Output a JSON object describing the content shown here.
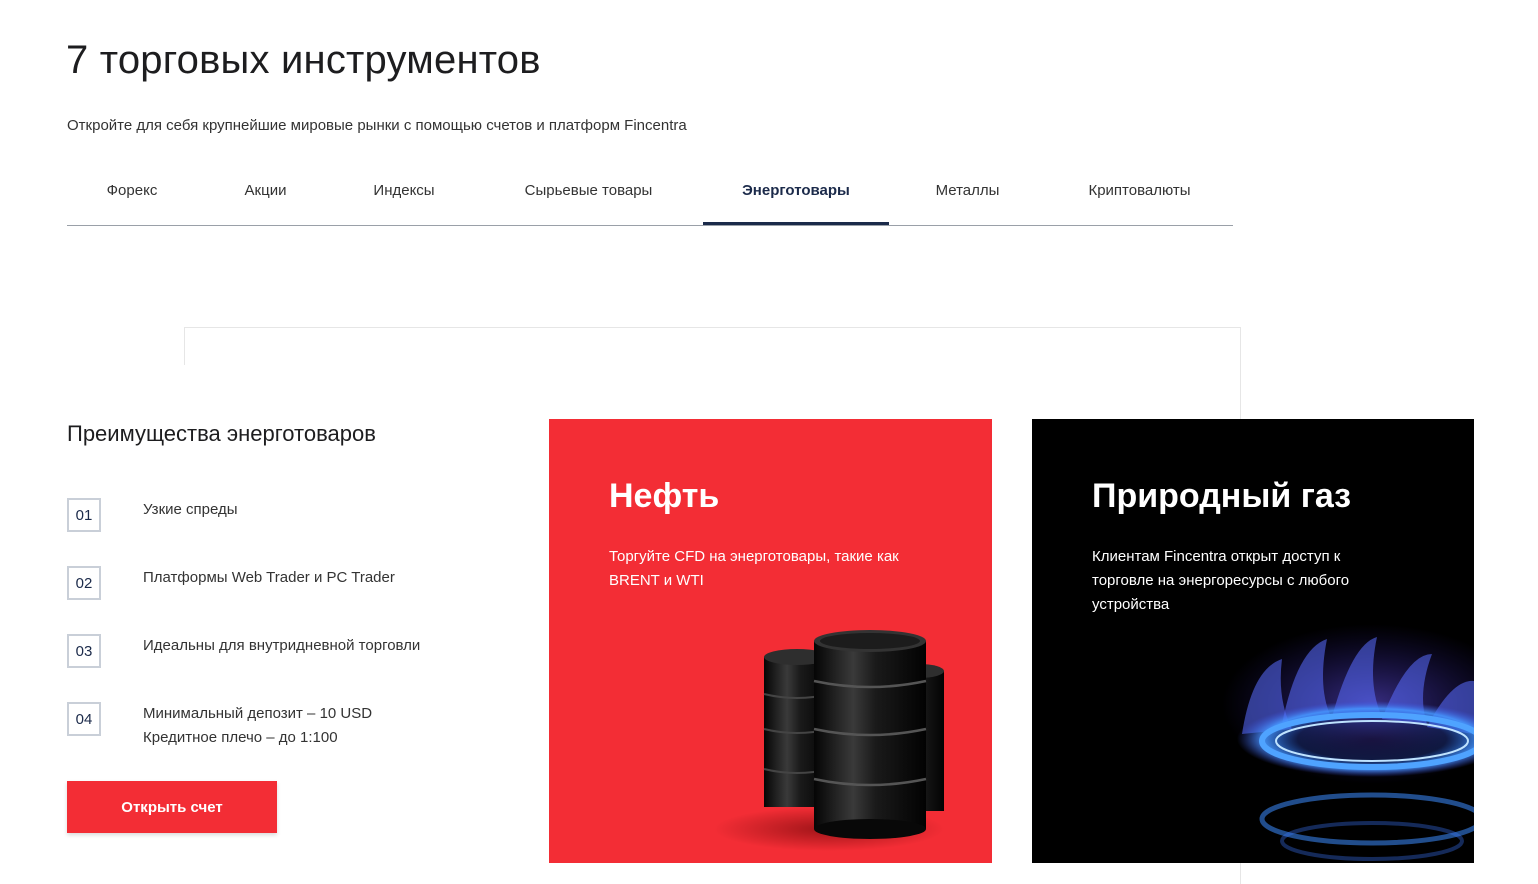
{
  "section": {
    "title": "7 торговых инструментов",
    "subtitle": "Откройте для себя крупнейшие мировые рынки с помощью счетов и платформ Fincentra"
  },
  "tabs": [
    {
      "label": "Форекс",
      "active": false
    },
    {
      "label": "Акции",
      "active": false
    },
    {
      "label": "Индексы",
      "active": false
    },
    {
      "label": "Сырьевые товары",
      "active": false
    },
    {
      "label": "Энерготовары",
      "active": true
    },
    {
      "label": "Металлы",
      "active": false
    },
    {
      "label": "Криптовалюты",
      "active": false
    }
  ],
  "advantages": {
    "title": "Преимущества энерготоваров",
    "items": [
      {
        "num": "01",
        "lines": [
          "Узкие спреды"
        ]
      },
      {
        "num": "02",
        "lines": [
          "Платформы Web Trader и PC Trader"
        ]
      },
      {
        "num": "03",
        "lines": [
          "Идеальны для внутридневной торговли"
        ]
      },
      {
        "num": "04",
        "lines": [
          "Минимальный депозит – 10 USD",
          "Кредитное плечо – до 1:100"
        ]
      }
    ],
    "cta_label": "Открыть счет"
  },
  "cards": {
    "oil": {
      "title": "Нефть",
      "text": "Торгуйте CFD на энерготовары, такие как BRENT и WTI",
      "illustration": "oil-barrels-icon"
    },
    "gas": {
      "title": "Природный газ",
      "text": "Клиентам Fincentra открыт доступ к торговле на энергоресурсы с любого устройства",
      "illustration": "gas-flame-icon"
    }
  },
  "colors": {
    "accent_red": "#f32d35",
    "navy": "#1b2a4a",
    "card_dark": "#000000"
  }
}
